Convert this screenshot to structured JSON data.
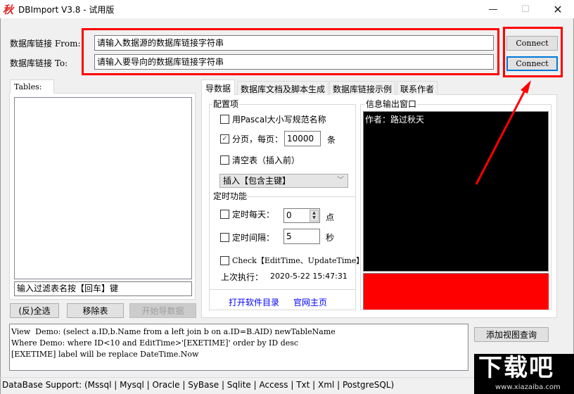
{
  "window": {
    "icon_glyph": "秋",
    "title": "DBImport V3.8 - 试用版",
    "minimize_glyph": "—",
    "maximize_glyph": "☐",
    "close_glyph": "✕"
  },
  "connection": {
    "from_label": "数据库链接 From:",
    "to_label": "数据库链接 To:",
    "from_value": "请输入数据源的数据库链接字符串",
    "to_value": "请输入要导向的数据库链接字符串",
    "connect_from_label": "Connect",
    "connect_to_label": "Connect"
  },
  "tables_panel": {
    "tab_label": "Tables:",
    "filter_value": "输入过滤表名按【回车】键",
    "select_all_label": "(反)全选",
    "remove_label": "移除表",
    "start_import_label": "开始导数据"
  },
  "tabs": [
    {
      "label": "导数据",
      "active": true
    },
    {
      "label": "数据库文档及脚本生成",
      "active": false
    },
    {
      "label": "数据库链接示例",
      "active": false
    },
    {
      "label": "联系作者",
      "active": false
    }
  ],
  "config": {
    "group_title": "配置项",
    "pascal_label": "用Pascal大小写规范名称",
    "pascal_checked": false,
    "paging_label": "分页，每页：",
    "paging_checked": true,
    "check_glyph": "✓",
    "page_size": "10000",
    "page_unit": "条",
    "clear_label": "清空表（插入前）",
    "clear_checked": false,
    "insert_mode": "插入【包含主键】",
    "chevron_glyph": "﹀"
  },
  "timer": {
    "group_title": "定时功能",
    "daily_label": "定时每天：",
    "daily_checked": false,
    "daily_value": "0",
    "daily_unit": "点",
    "spin_up": "▲",
    "spin_down": "▼",
    "interval_label": "定时间隔：",
    "interval_checked": false,
    "interval_value": "5",
    "interval_unit": "秒",
    "check_label": "Check【EditTime、UpdateTime】",
    "check_checked": false,
    "last_run_label": "上次执行：",
    "last_run_value": "2020-5-22 15:47:31"
  },
  "links": {
    "open_dir": "打开软件目录",
    "homepage": "官网主页"
  },
  "output": {
    "title": "信息输出窗口",
    "text": "作者：路过秋天",
    "status_color": "#ff0000"
  },
  "sql_demo": {
    "lines": [
      "View  Demo: (select a.ID,b.Name from a left join b on a.ID=B.AID) newTableName",
      "Where Demo: where ID<10 and EditTime>'[EXETIME]' order by ID desc",
      "[EXETIME] label will be replace DateTime.Now"
    ]
  },
  "add_view_label": "添加视图查询",
  "db_support": "DataBase Support:   (Mssql | Mysql | Oracle | SyBase | Sqlite | Access | Txt | Xml | PostgreSQL)",
  "watermark": {
    "main": "下载吧",
    "url": "www.xiazaiba.com"
  },
  "colors": {
    "highlight_red": "#ff0000",
    "focus_blue": "#0078d7",
    "link_blue": "#0000ff"
  }
}
